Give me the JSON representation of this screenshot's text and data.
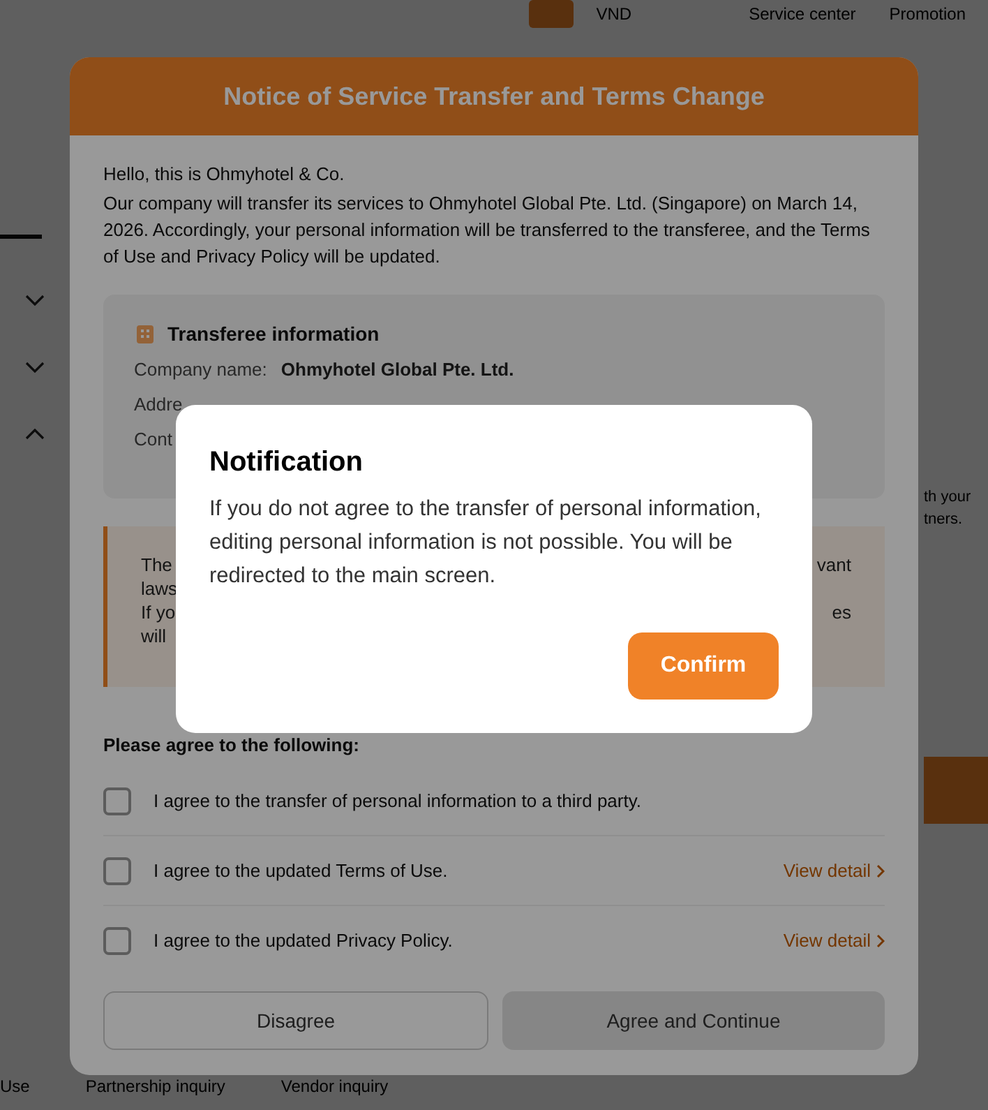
{
  "page": {
    "currency": "VND",
    "links": [
      "Service center",
      "Promotion"
    ],
    "side_text": [
      "th your",
      "tners."
    ],
    "footer_links": [
      "Use",
      "Partnership inquiry",
      "Vendor inquiry"
    ]
  },
  "notice": {
    "title": "Notice of Service Transfer and Terms Change",
    "greeting": "Hello, this is Ohmyhotel & Co.",
    "paragraph": "Our company will transfer its services to Ohmyhotel Global Pte. Ltd. (Singapore) on March 14, 2026. Accordingly, your personal information will be transferred to the transferee, and the Terms of Use and Privacy Policy will be updated.",
    "transferee": {
      "title": "Transferee information",
      "rows": [
        {
          "label": "Company name:",
          "value": "Ohmyhotel Global Pte. Ltd."
        },
        {
          "label": "Addre"
        },
        {
          "label": "Cont"
        }
      ]
    },
    "warning": {
      "lines": [
        {
          "left": "The",
          "right": "vant"
        },
        {
          "left": "laws"
        },
        {
          "left": "If yo",
          "right": "es"
        },
        {
          "left": "will"
        }
      ]
    },
    "agree_prompt": "Please agree to the following:",
    "agreements": [
      {
        "label": "I agree to the transfer of personal information to a third party.",
        "checked": false
      },
      {
        "label": "I agree to the updated Terms of Use.",
        "checked": false,
        "link": "View detail"
      },
      {
        "label": "I agree to the updated Privacy Policy.",
        "checked": false,
        "link": "View detail"
      }
    ],
    "buttons": [
      {
        "label": "Disagree",
        "kind": "secondary",
        "disabled": false
      },
      {
        "label": "Agree and Continue",
        "kind": "primary",
        "disabled": true
      }
    ]
  },
  "notification": {
    "title": "Notification",
    "message": "If you do not agree to the transfer of personal information, editing personal information is not possible. You will be redirected to the main screen.",
    "button": "Confirm"
  }
}
